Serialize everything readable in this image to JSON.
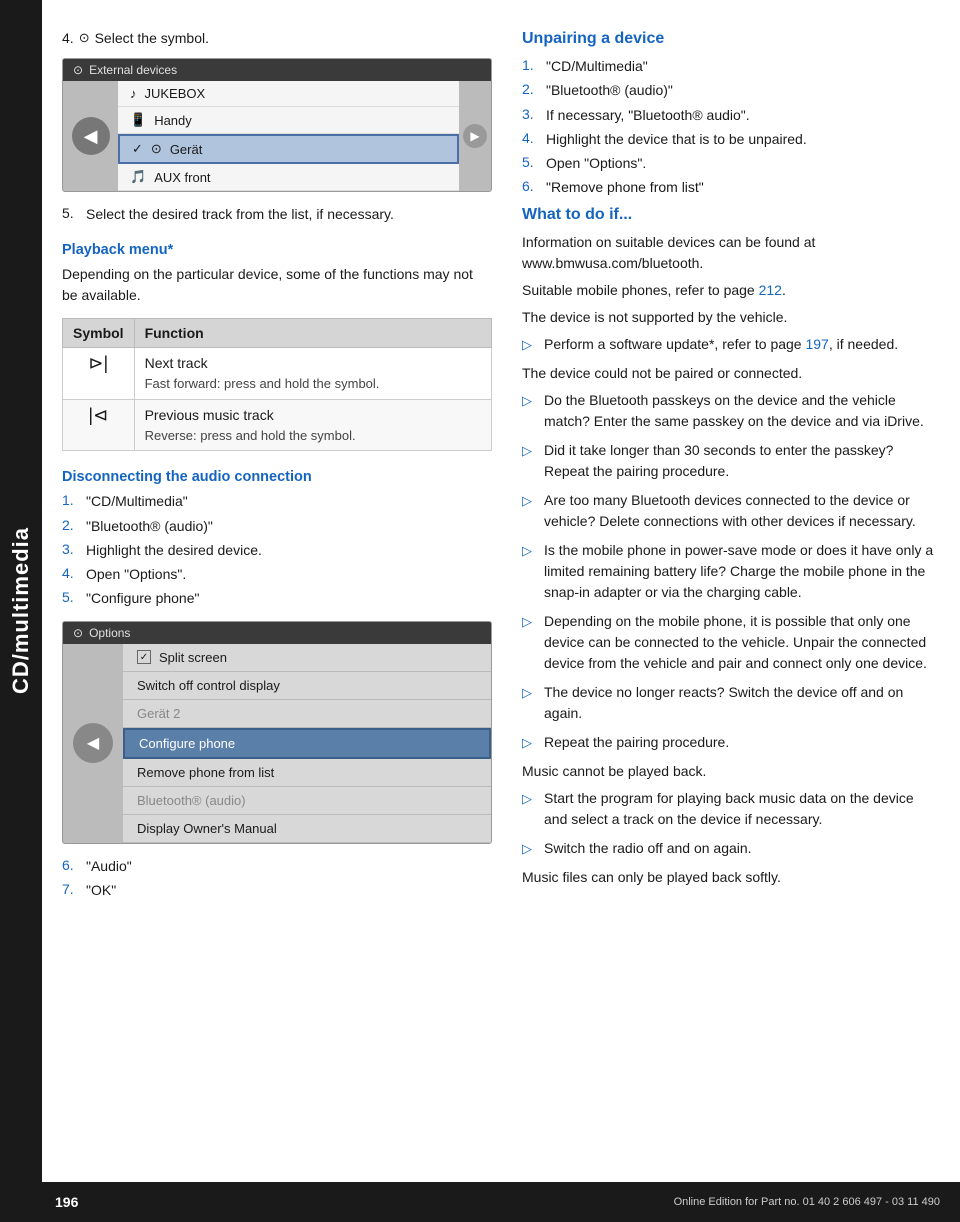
{
  "sidebar": {
    "label": "CD/multimedia"
  },
  "left": {
    "step4_label": "4.",
    "step4_icon": "⊙",
    "step4_text": "Select the symbol.",
    "device1": {
      "header_icon": "⊙",
      "header_title": "External devices",
      "items": [
        {
          "icon": "♪",
          "label": "JUKEBOX",
          "selected": false,
          "check": false
        },
        {
          "icon": "📱",
          "label": "Handy",
          "selected": false,
          "check": false
        },
        {
          "icon": "⊙",
          "label": "Gerät",
          "selected": true,
          "check": true
        },
        {
          "icon": "🎵",
          "label": "AUX front",
          "selected": false,
          "check": false
        }
      ]
    },
    "step5_num": "5.",
    "step5_text": "Select the desired track from the list, if necessary.",
    "playback_heading": "Playback menu*",
    "playback_desc": "Depending on the particular device, some of the functions may not be available.",
    "table": {
      "col1": "Symbol",
      "col2": "Function",
      "rows": [
        {
          "symbol": "⊳|",
          "func_main": "Next track",
          "func_sub": "Fast forward: press and hold the symbol."
        },
        {
          "symbol": "|⊲",
          "func_main": "Previous music track",
          "func_sub": "Reverse: press and hold the symbol."
        }
      ]
    },
    "disconnect_heading": "Disconnecting the audio connection",
    "disconnect_steps": [
      {
        "num": "1.",
        "text": "\"CD/Multimedia\""
      },
      {
        "num": "2.",
        "text": "\"Bluetooth® (audio)\""
      },
      {
        "num": "3.",
        "text": "Highlight the desired device."
      },
      {
        "num": "4.",
        "text": "Open \"Options\"."
      },
      {
        "num": "5.",
        "text": "\"Configure phone\""
      }
    ],
    "device2": {
      "header_icon": "⊙",
      "header_title": "Options",
      "menu_items": [
        {
          "label": "Split screen",
          "type": "check",
          "checked": true
        },
        {
          "label": "Switch off control display",
          "type": "normal"
        },
        {
          "label": "Gerät 2",
          "type": "grayed"
        },
        {
          "label": "Configure phone",
          "type": "highlighted"
        },
        {
          "label": "Remove phone from list",
          "type": "normal"
        },
        {
          "label": "Bluetooth® (audio)",
          "type": "grayed"
        },
        {
          "label": "Display Owner's Manual",
          "type": "normal"
        }
      ]
    },
    "steps_after": [
      {
        "num": "6.",
        "text": "\"Audio\""
      },
      {
        "num": "7.",
        "text": "\"OK\""
      }
    ]
  },
  "right": {
    "unpair_heading": "Unpairing a device",
    "unpair_steps": [
      {
        "num": "1.",
        "text": "\"CD/Multimedia\""
      },
      {
        "num": "2.",
        "text": "\"Bluetooth® (audio)\""
      },
      {
        "num": "3.",
        "text": "If necessary, \"Bluetooth® audio\"."
      },
      {
        "num": "4.",
        "text": "Highlight the device that is to be unpaired."
      },
      {
        "num": "5.",
        "text": "Open \"Options\"."
      },
      {
        "num": "6.",
        "text": "\"Remove phone from list\""
      }
    ],
    "what_heading": "What to do if...",
    "para1": "Information on suitable devices can be found at www.bmwusa.com/bluetooth.",
    "para2_prefix": "Suitable mobile phones, refer to page ",
    "para2_link": "212",
    "para2_suffix": ".",
    "para3": "The device is not supported by the vehicle.",
    "bullets1": [
      {
        "prefix": "Perform a software update*, refer to page ",
        "link": "197",
        "suffix": ", if needed."
      }
    ],
    "para4": "The device could not be paired or connected.",
    "bullets2": [
      {
        "text": "Do the Bluetooth passkeys on the device and the vehicle match? Enter the same passkey on the device and via iDrive."
      },
      {
        "text": "Did it take longer than 30 seconds to enter the passkey? Repeat the pairing procedure."
      },
      {
        "text": "Are too many Bluetooth devices connected to the device or vehicle? Delete connections with other devices if necessary."
      },
      {
        "text": "Is the mobile phone in power-save mode or does it have only a limited remaining battery life? Charge the mobile phone in the snap-in adapter or via the charging cable."
      },
      {
        "text": "Depending on the mobile phone, it is possible that only one device can be connected to the vehicle. Unpair the connected device from the vehicle and pair and connect only one device."
      },
      {
        "text": "The device no longer reacts? Switch the device off and on again."
      },
      {
        "text": "Repeat the pairing procedure."
      }
    ],
    "para5": "Music cannot be played back.",
    "bullets3": [
      {
        "text": "Start the program for playing back music data on the device and select a track on the device if necessary."
      },
      {
        "text": "Switch the radio off and on again."
      }
    ],
    "para6": "Music files can only be played back softly."
  },
  "footer": {
    "page_num": "196",
    "text": "Online Edition for Part no. 01 40 2 606 497 - 03 11 490"
  }
}
